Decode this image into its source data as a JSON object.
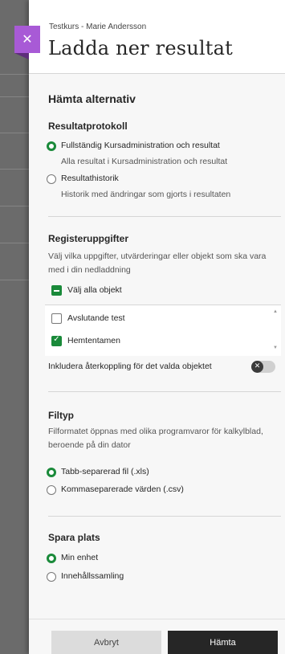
{
  "header": {
    "course": "Testkurs - Marie Andersson",
    "title": "Ladda ner resultat",
    "close_glyph": "✕"
  },
  "options": {
    "heading": "Hämta alternativ",
    "protocol": {
      "title": "Resultatprotokoll",
      "items": [
        {
          "label": "Fullständig Kursadministration och resultat",
          "sub": "Alla resultat i Kursadministration och resultat",
          "selected": true
        },
        {
          "label": "Resultathistorik",
          "sub": "Historik med ändringar som gjorts i resultaten",
          "selected": false
        }
      ]
    },
    "records": {
      "title": "Registeruppgifter",
      "description": "Välj vilka uppgifter, utvärderingar eller objekt som ska vara med i din nedladdning",
      "select_all": "Välj alla objekt",
      "items": [
        {
          "label": "Avslutande test",
          "checked": false
        },
        {
          "label": "Hemtentamen",
          "checked": true
        }
      ],
      "feedback_label": "Inkludera återkoppling för det valda objektet",
      "feedback_enabled": false
    },
    "filetype": {
      "title": "Filtyp",
      "description": "Filformatet öppnas med olika programvaror för kalkylblad, beroende på din dator",
      "items": [
        {
          "label": "Tabb-separerad fil (.xls)",
          "selected": true
        },
        {
          "label": "Kommaseparerade värden (.csv)",
          "selected": false
        }
      ]
    },
    "location": {
      "title": "Spara plats",
      "items": [
        {
          "label": "Min enhet",
          "selected": true
        },
        {
          "label": "Innehållssamling",
          "selected": false
        }
      ]
    }
  },
  "footer": {
    "cancel": "Avbryt",
    "submit": "Hämta"
  },
  "colors": {
    "accent_green": "#1a8a3a",
    "close_tab": "#a85ad6",
    "primary_button": "#262626"
  }
}
